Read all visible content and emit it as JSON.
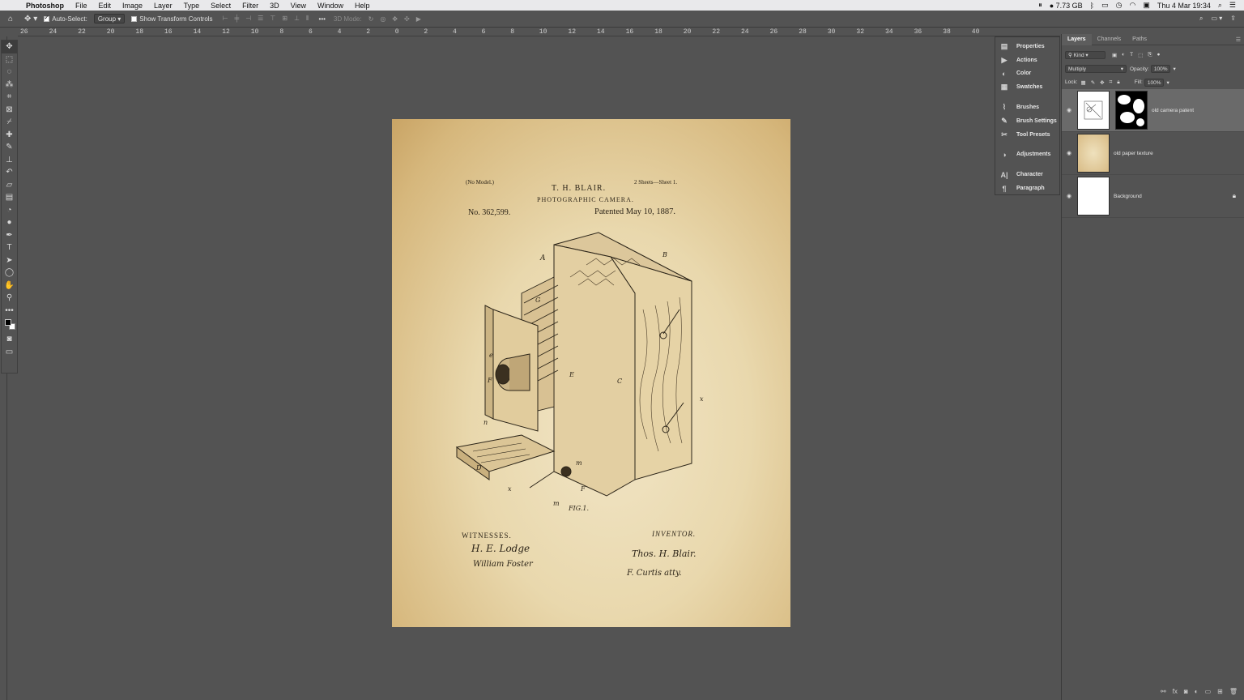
{
  "menubar": {
    "app": "Photoshop",
    "items": [
      "File",
      "Edit",
      "Image",
      "Layer",
      "Type",
      "Select",
      "Filter",
      "3D",
      "View",
      "Window",
      "Help"
    ],
    "memory": "7.73 GB",
    "datetime": "Thu 4 Mar  19:34"
  },
  "options": {
    "auto_select_label": "Auto-Select:",
    "auto_select_target": "Group",
    "transform_label": "Show Transform Controls",
    "mode_label": "3D Mode:"
  },
  "ruler": {
    "labels": [
      "26",
      "24",
      "22",
      "20",
      "18",
      "16",
      "14",
      "12",
      "10",
      "8",
      "6",
      "4",
      "2",
      "0",
      "2",
      "4",
      "6",
      "8",
      "10",
      "12",
      "14",
      "16",
      "18",
      "20",
      "22",
      "24",
      "26",
      "28",
      "30",
      "32",
      "34",
      "36",
      "38",
      "40"
    ]
  },
  "document": {
    "no_model": "(No Model.)",
    "sheets": "2 Sheets—Sheet 1.",
    "inventor_name": "T. H. BLAIR.",
    "title": "PHOTOGRAPHIC CAMERA.",
    "patent_no": "No. 362,599.",
    "patent_date": "Patented May 10, 1887.",
    "fig": "FIG.1.",
    "witnesses": "WITNESSES.",
    "inventor_label": "INVENTOR.",
    "sig_witness_1": "H. E. Lodge",
    "sig_witness_2": "William Foster",
    "sig_inventor": "Thos. H. Blair.",
    "sig_attorney": "F. Curtis atty.",
    "letters": [
      "A",
      "B",
      "G",
      "e",
      "F",
      "C",
      "E",
      "n",
      "D",
      "x",
      "m",
      "x",
      "F",
      "m"
    ]
  },
  "dock": {
    "items": [
      "Properties",
      "Actions",
      "Color",
      "Swatches",
      "Brushes",
      "Brush Settings",
      "Tool Presets",
      "Adjustments",
      "Character",
      "Paragraph"
    ]
  },
  "layers_panel": {
    "tabs": [
      "Layers",
      "Channels",
      "Paths"
    ],
    "filter": "Kind",
    "blend_mode": "Multiply",
    "opacity_label": "Opacity:",
    "opacity": "100%",
    "lock_label": "Lock:",
    "fill_label": "Fill:",
    "fill": "100%",
    "layers": [
      {
        "name": "old camera patent"
      },
      {
        "name": "old paper texture"
      },
      {
        "name": "Background"
      }
    ]
  }
}
